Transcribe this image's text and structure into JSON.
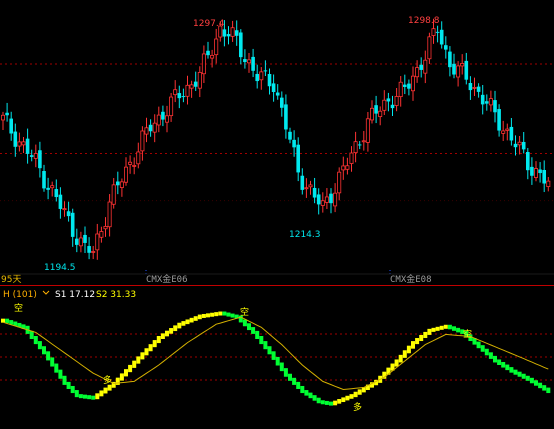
{
  "colors": {
    "background": "#000000",
    "up": "#ff3333",
    "down": "#00e8ee",
    "grid": "#a00000",
    "divider": "#c00000",
    "separator": "#2050ff",
    "indicator_up": "#ffff00",
    "indicator_down": "#00ff33",
    "signal": "#d4b000",
    "days_text": "#e6b800",
    "h_text": "#ffb000",
    "s1_text": "#ffffff",
    "s2_text": "#ffff00",
    "contract_text": "#9a9a9a",
    "high_label": "#ff4040",
    "low_label": "#00e8ee"
  },
  "header": {
    "days_label": "95天",
    "indicator_name": "H (101)",
    "s1_label": "S1 17.12",
    "s2_label": "S2 31.33"
  },
  "annotations": {
    "high1": "1297.4",
    "high2": "1298.8",
    "low1": "1214.3",
    "low0": "1194.5",
    "contract1": "CMX金E06",
    "contract2": "CMX金E08",
    "mark_a": "空",
    "mark_b": "多",
    "mark_c": "空",
    "mark_d": "多",
    "mark_e": "空"
  },
  "chart_data": [
    {
      "type": "candlestick",
      "anchors": [
        [
          0,
          1255
        ],
        [
          8,
          1236
        ],
        [
          15,
          1213
        ],
        [
          20,
          1197
        ],
        [
          22,
          1196
        ],
        [
          26,
          1218
        ],
        [
          31,
          1236
        ],
        [
          36,
          1252
        ],
        [
          43,
          1266
        ],
        [
          48,
          1275
        ],
        [
          53,
          1296
        ],
        [
          57,
          1290
        ],
        [
          62,
          1274
        ],
        [
          66,
          1272
        ],
        [
          72,
          1232
        ],
        [
          76,
          1220
        ],
        [
          78,
          1216
        ],
        [
          83,
          1232
        ],
        [
          89,
          1254
        ],
        [
          94,
          1264
        ],
        [
          98,
          1268
        ],
        [
          103,
          1284
        ],
        [
          106,
          1296
        ],
        [
          109,
          1280
        ],
        [
          114,
          1272
        ],
        [
          118,
          1262
        ],
        [
          122,
          1252
        ],
        [
          128,
          1236
        ],
        [
          133,
          1226
        ]
      ],
      "y_ticks": [
        1240,
        1280
      ],
      "y_dotted": [
        1219
      ],
      "highs": [
        {
          "value": 1297.4,
          "label": "1297.4"
        },
        {
          "value": 1298.8,
          "label": "1298.8"
        }
      ],
      "lows": [
        {
          "value": 1214.3,
          "label": "1214.3"
        },
        {
          "value": 1194.5,
          "label": "1194.5"
        }
      ]
    },
    {
      "type": "indicator",
      "name": "H (101)",
      "series": [
        {
          "name": "S1",
          "last": 17.12
        },
        {
          "name": "S2",
          "last": 31.33
        }
      ],
      "h_anchors": [
        [
          0,
          92
        ],
        [
          5,
          85
        ],
        [
          10,
          60
        ],
        [
          15,
          30
        ],
        [
          18,
          18
        ],
        [
          22,
          16
        ],
        [
          27,
          30
        ],
        [
          33,
          55
        ],
        [
          38,
          75
        ],
        [
          43,
          88
        ],
        [
          48,
          96
        ],
        [
          53,
          99
        ],
        [
          57,
          95
        ],
        [
          61,
          80
        ],
        [
          65,
          60
        ],
        [
          69,
          38
        ],
        [
          73,
          22
        ],
        [
          77,
          12
        ],
        [
          80,
          10
        ],
        [
          85,
          18
        ],
        [
          91,
          32
        ],
        [
          96,
          52
        ],
        [
          100,
          70
        ],
        [
          104,
          82
        ],
        [
          108,
          86
        ],
        [
          112,
          80
        ],
        [
          116,
          66
        ],
        [
          120,
          52
        ],
        [
          124,
          42
        ],
        [
          128,
          34
        ],
        [
          133,
          22
        ]
      ],
      "signal_anchors": [
        [
          0,
          90
        ],
        [
          8,
          80
        ],
        [
          15,
          60
        ],
        [
          22,
          40
        ],
        [
          27,
          30
        ],
        [
          32,
          32
        ],
        [
          38,
          48
        ],
        [
          45,
          70
        ],
        [
          52,
          88
        ],
        [
          58,
          95
        ],
        [
          63,
          85
        ],
        [
          68,
          68
        ],
        [
          73,
          48
        ],
        [
          78,
          32
        ],
        [
          83,
          24
        ],
        [
          88,
          26
        ],
        [
          93,
          36
        ],
        [
          98,
          52
        ],
        [
          103,
          68
        ],
        [
          108,
          78
        ],
        [
          114,
          76
        ],
        [
          120,
          66
        ],
        [
          126,
          56
        ],
        [
          133,
          44
        ]
      ]
    }
  ]
}
